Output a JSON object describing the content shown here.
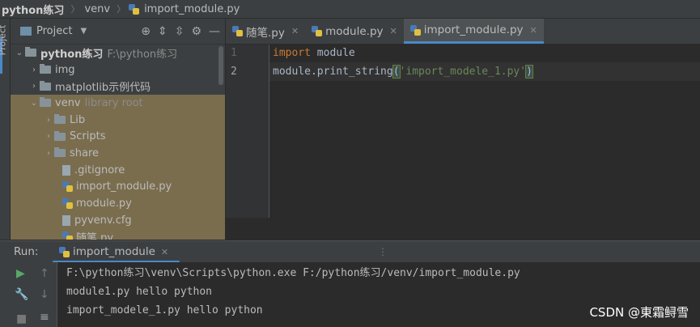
{
  "breadcrumb": {
    "project": "python练习",
    "folder": "venv",
    "file": "import_module.py"
  },
  "side_strip": {
    "label": "Project"
  },
  "project_panel": {
    "header": {
      "label": "Project",
      "icons": [
        "crosshair-icon",
        "expand-all-icon",
        "collapse-all-icon",
        "gear-icon",
        "minimize-icon"
      ]
    },
    "tree": [
      {
        "name": "python练习",
        "hint": "F:\\python练习",
        "type": "folder",
        "expanded": true
      },
      {
        "name": "img",
        "type": "folder",
        "expanded": false
      },
      {
        "name": "matplotlib示例代码",
        "type": "folder",
        "expanded": false
      },
      {
        "name": "venv",
        "hint": "library root",
        "type": "folder",
        "expanded": true
      },
      {
        "name": "Lib",
        "type": "folder",
        "expanded": false
      },
      {
        "name": "Scripts",
        "type": "folder",
        "expanded": false
      },
      {
        "name": "share",
        "type": "folder",
        "expanded": false
      },
      {
        "name": ".gitignore",
        "type": "file"
      },
      {
        "name": "import_module.py",
        "type": "python"
      },
      {
        "name": "module.py",
        "type": "python"
      },
      {
        "name": "pyvenv.cfg",
        "type": "file"
      },
      {
        "name": "随笔.py",
        "type": "python"
      }
    ]
  },
  "editor": {
    "tabs": [
      {
        "label": "随笔.py",
        "active": false
      },
      {
        "label": "module.py",
        "active": false
      },
      {
        "label": "import_module.py",
        "active": true
      }
    ],
    "line_numbers": [
      "1",
      "2"
    ],
    "code": {
      "line1": {
        "kw": "import",
        "rest": " module"
      },
      "line2": {
        "obj": "module.print_string",
        "open": "(",
        "str": "'import_modele_1.py'",
        "close": ")"
      }
    }
  },
  "run": {
    "label": "Run:",
    "tab_label": "import_module",
    "console": [
      "F:\\python练习\\venv\\Scripts\\python.exe F:/python练习/venv/import_module.py",
      "module1.py hello python",
      "import_modele_1.py hello python"
    ]
  },
  "watermark": "CSDN @東霜鲟雪",
  "colors": {
    "accent": "#4a88c7",
    "keyword": "#cc7832",
    "string": "#6a8759",
    "selected_row": "#7a6d4e"
  }
}
